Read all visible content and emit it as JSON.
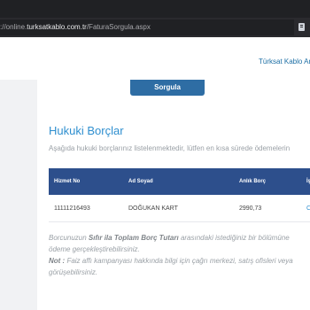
{
  "browser": {
    "url_prefix": "://online.",
    "url_domain": "turksatkablo.com.tr",
    "url_path": "/FaturaSorgula.aspx"
  },
  "header": {
    "brand_link": "Türksat Kablo An"
  },
  "page": {
    "query_button": "Sorgula",
    "title": "Hukuki Borçlar",
    "subtitle": "Aşağıda hukuki borçlarınız listelenmektedir, lütfen en kısa sürede ödemelerin"
  },
  "table": {
    "headers": [
      "Hizmet No",
      "Ad Soyad",
      "Anlık Borç",
      "İş"
    ],
    "rows": [
      [
        "11111216493",
        "DOĞUKAN KART",
        "2990,73",
        "C"
      ]
    ]
  },
  "note": {
    "p1_pre": "Borcunuzun ",
    "p1_bold": "Sıfır ila Toplam Borç Tutarı",
    "p1_post": " arasındaki istediğiniz bir bölümüne",
    "p1_line2": "ödeme gerçekleştirebilirsiniz.",
    "p2_bold": "Not :",
    "p2_text": " Faiz affı kampanyası hakkında bilgi için çağrı merkezi, satış ofisleri veya",
    "p2_line2": "görüşebilirsiniz."
  },
  "colors": {
    "accent": "#2f8fcf",
    "table_header": "#2d4f8c",
    "button": "#2e6da4"
  }
}
